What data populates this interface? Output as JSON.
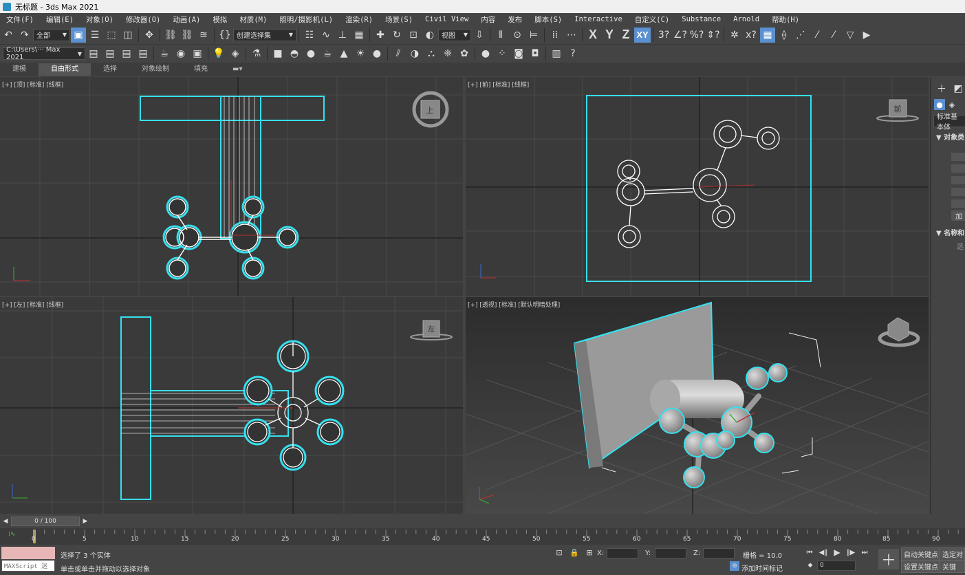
{
  "window": {
    "title": "无标题 - 3ds Max 2021"
  },
  "menu": [
    "文件(F)",
    "编辑(E)",
    "对象(O)",
    "修改器(O)",
    "动画(A)",
    "模拟",
    "材质(M)",
    "照明/摄影机(L)",
    "渲染(R)",
    "场景(S)",
    "Civil View",
    "内容",
    "发布",
    "脚本(S)",
    "Interactive",
    "自定义(C)",
    "Substance",
    "Arnold",
    "帮助(H)"
  ],
  "toolbar": {
    "filter_dropdown": "全部",
    "selection_set": "创建选择集",
    "ref_coord": "视图",
    "path_dropdown": "C:\\Users\\··· Max 2021",
    "axis_x": "X",
    "axis_y": "Y",
    "axis_z": "Z",
    "axis_xy": "XY"
  },
  "ribbon_tabs": [
    "建模",
    "自由形式",
    "选择",
    "对象绘制",
    "填充"
  ],
  "viewports": {
    "top": "[+] [顶] [标准] [线框]",
    "front": "[+] [前] [标准] [线框]",
    "left": "[+] [左] [标准] [线框]",
    "persp": "[+] [透视] [标准] [默认明暗处理]",
    "top_cube": "上",
    "front_cube": "前",
    "left_cube": "左"
  },
  "command_panel": {
    "dropdown": "标准基本体",
    "rollout1": "▼ 对象类",
    "rollout2": "▼ 名称和",
    "btn_add": "加",
    "btn_sel": "选"
  },
  "timeline": {
    "frame": "0 / 100",
    "ticks": [
      "0",
      "5",
      "10",
      "15",
      "20",
      "25",
      "30",
      "35",
      "40",
      "45",
      "50",
      "55",
      "60",
      "65",
      "70",
      "75",
      "80",
      "85",
      "90"
    ]
  },
  "status": {
    "maxscript": "MAXScript 迷",
    "selected": "选择了 3 个实体",
    "hint": "单击或单击并拖动以选择对象",
    "x_label": "X:",
    "y_label": "Y:",
    "z_label": "Z:",
    "grid": "栅格 = 10.0",
    "add_time_tag": "添加时间标记",
    "auto_key": "自动关键点",
    "set_key": "设置关键点",
    "selected_obj": "选定对",
    "key_filter": "关键",
    "frame_field": "0"
  },
  "colors": {
    "select": "#36e0ee",
    "wire": "#ffffff",
    "bg": "#3a3a3a",
    "grid": "#4a4a4a",
    "accent": "#5a8fd0"
  }
}
